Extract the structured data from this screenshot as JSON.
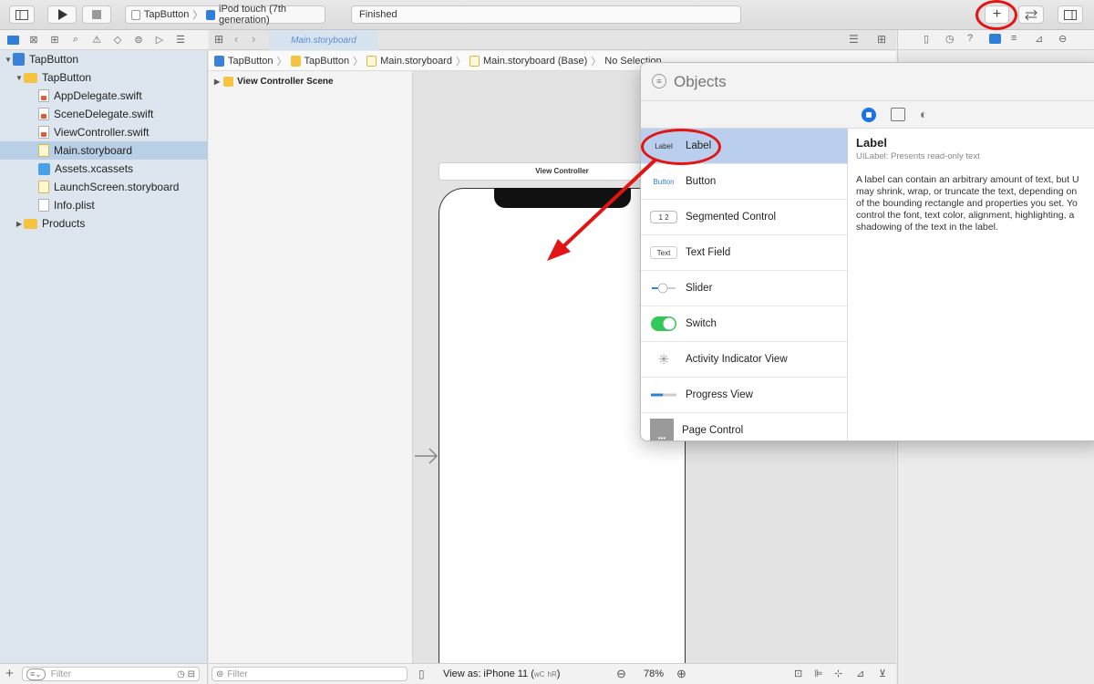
{
  "toolbar": {
    "scheme_app": "TapButton",
    "scheme_device": "iPod touch (7th generation)",
    "status": "Finished",
    "add_symbol": "+"
  },
  "navigator": {
    "filter_placeholder": "Filter",
    "tree": [
      {
        "label": "TapButton",
        "kind": "project",
        "level": 0
      },
      {
        "label": "TapButton",
        "kind": "folder",
        "level": 1
      },
      {
        "label": "AppDelegate.swift",
        "kind": "swift",
        "level": 2
      },
      {
        "label": "SceneDelegate.swift",
        "kind": "swift",
        "level": 2
      },
      {
        "label": "ViewController.swift",
        "kind": "swift",
        "level": 2
      },
      {
        "label": "Main.storyboard",
        "kind": "storyboard",
        "level": 2,
        "selected": true
      },
      {
        "label": "Assets.xcassets",
        "kind": "assets",
        "level": 2
      },
      {
        "label": "LaunchScreen.storyboard",
        "kind": "storyboard",
        "level": 2
      },
      {
        "label": "Info.plist",
        "kind": "plist",
        "level": 2
      },
      {
        "label": "Products",
        "kind": "folder",
        "level": 1
      }
    ]
  },
  "editor": {
    "tab_title": "Main.storyboard",
    "breadcrumb": [
      "TapButton",
      "TapButton",
      "Main.storyboard",
      "Main.storyboard (Base)",
      "No Selection"
    ],
    "outline_scene": "View Controller Scene",
    "vc_title": "View Controller",
    "filter_placeholder": "Filter",
    "view_as": "View as: iPhone 11 (",
    "view_as_wc": "wC",
    "view_as_hr": "hR",
    "view_as_close": ")",
    "zoom": "78%",
    "zoom_out": "⊖",
    "zoom_in": "⊕"
  },
  "library": {
    "search_placeholder": "Objects",
    "items": [
      {
        "name": "Label",
        "thumb": "Label"
      },
      {
        "name": "Button",
        "thumb": "Button"
      },
      {
        "name": "Segmented Control",
        "thumb": "1 2"
      },
      {
        "name": "Text Field",
        "thumb": "Text"
      },
      {
        "name": "Slider",
        "thumb": ""
      },
      {
        "name": "Switch",
        "thumb": ""
      },
      {
        "name": "Activity Indicator View",
        "thumb": ""
      },
      {
        "name": "Progress View",
        "thumb": ""
      },
      {
        "name": "Page Control",
        "thumb": ""
      }
    ],
    "detail": {
      "title": "Label",
      "subtitle": "UILabel: Presents read-only text",
      "lines": [
        "A label can contain an arbitrary amount of text, but U",
        "may shrink, wrap, or truncate the text, depending on",
        "of the bounding rectangle and properties you set. Yo",
        "control the font, text color, alignment, highlighting, a",
        "shadowing of the text in the label."
      ]
    }
  },
  "annotations": {
    "highlight_color": "#e21414"
  }
}
